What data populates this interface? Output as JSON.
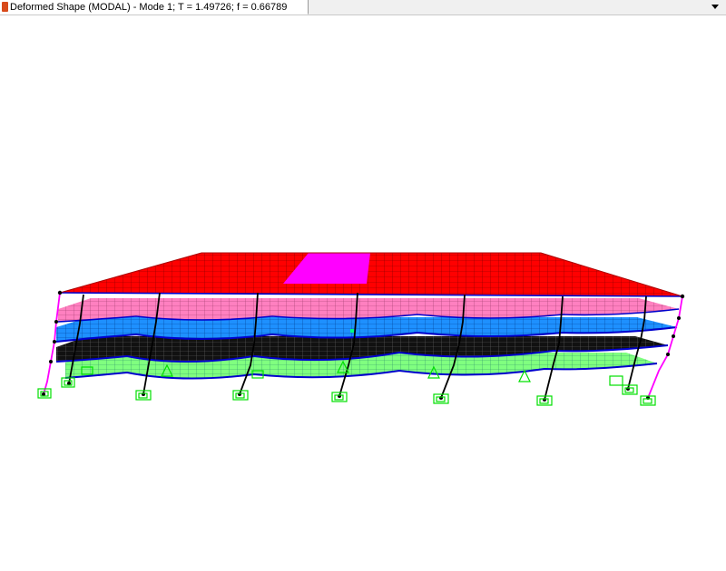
{
  "window": {
    "tab_title": "Deformed Shape (MODAL) - Mode 1; T = 1.49726;  f = 0.66789",
    "tab_icon": "model-window-icon",
    "menu_icon": "chevron-down-icon"
  },
  "view": {
    "description_icon": "deformed-frame-model",
    "colors": {
      "roof": "#ff0000",
      "opening": "#ff00ff",
      "level_4": "#ff80c0",
      "level_3": "#1e90ff",
      "level_2": "#111111",
      "level_1": "#80ff80",
      "columns_outer": "#ff00ff",
      "columns_inner": "#000000",
      "beams": "#0000cc",
      "supports": "#00e000"
    }
  }
}
